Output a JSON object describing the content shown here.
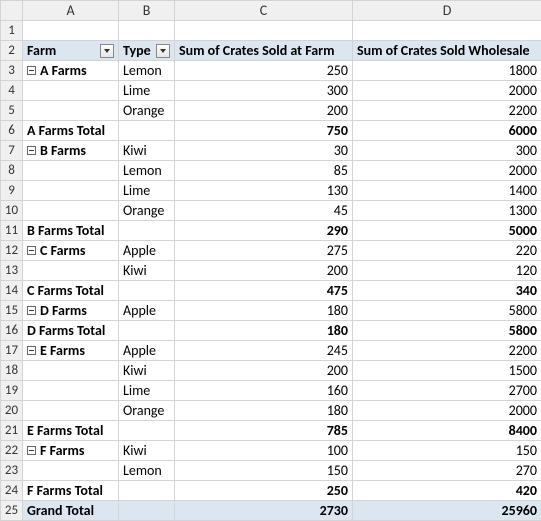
{
  "columns": [
    "A",
    "B",
    "C",
    "D"
  ],
  "header_row": 2,
  "headers": {
    "farm": "Farm",
    "type": "Type",
    "sum_farm": "Sum of Crates Sold at Farm",
    "sum_wholesale": "Sum of Crates Sold Wholesale"
  },
  "groups": [
    {
      "name": "A Farms",
      "rows": [
        {
          "type": "Lemon",
          "farm": 250,
          "whole": 1800
        },
        {
          "type": "Lime",
          "farm": 300,
          "whole": 2000
        },
        {
          "type": "Orange",
          "farm": 200,
          "whole": 2200
        }
      ],
      "subtotal": {
        "label": "A Farms Total",
        "farm": 750,
        "whole": 6000
      }
    },
    {
      "name": "B Farms",
      "rows": [
        {
          "type": "Kiwi",
          "farm": 30,
          "whole": 300
        },
        {
          "type": "Lemon",
          "farm": 85,
          "whole": 2000
        },
        {
          "type": "Lime",
          "farm": 130,
          "whole": 1400
        },
        {
          "type": "Orange",
          "farm": 45,
          "whole": 1300
        }
      ],
      "subtotal": {
        "label": "B Farms Total",
        "farm": 290,
        "whole": 5000
      }
    },
    {
      "name": "C Farms",
      "rows": [
        {
          "type": "Apple",
          "farm": 275,
          "whole": 220
        },
        {
          "type": "Kiwi",
          "farm": 200,
          "whole": 120
        }
      ],
      "subtotal": {
        "label": "C Farms Total",
        "farm": 475,
        "whole": 340
      }
    },
    {
      "name": "D Farms",
      "rows": [
        {
          "type": "Apple",
          "farm": 180,
          "whole": 5800
        }
      ],
      "subtotal": {
        "label": "D Farms Total",
        "farm": 180,
        "whole": 5800
      }
    },
    {
      "name": "E Farms",
      "rows": [
        {
          "type": "Apple",
          "farm": 245,
          "whole": 2200
        },
        {
          "type": "Kiwi",
          "farm": 200,
          "whole": 1500
        },
        {
          "type": "Lime",
          "farm": 160,
          "whole": 2700
        },
        {
          "type": "Orange",
          "farm": 180,
          "whole": 2000
        }
      ],
      "subtotal": {
        "label": "E Farms Total",
        "farm": 785,
        "whole": 8400
      }
    },
    {
      "name": "F Farms",
      "rows": [
        {
          "type": "Kiwi",
          "farm": 100,
          "whole": 150
        },
        {
          "type": "Lemon",
          "farm": 150,
          "whole": 270
        }
      ],
      "subtotal": {
        "label": "F Farms Total",
        "farm": 250,
        "whole": 420
      }
    }
  ],
  "grand_total": {
    "label": "Grand Total",
    "farm": 2730,
    "whole": 25960
  },
  "chart_data": {
    "type": "table",
    "title": "Pivot table: crates sold by farm and fruit type",
    "columns": [
      "Farm",
      "Type",
      "Sum of Crates Sold at Farm",
      "Sum of Crates Sold Wholesale"
    ],
    "rows": [
      [
        "A Farms",
        "Lemon",
        250,
        1800
      ],
      [
        "A Farms",
        "Lime",
        300,
        2000
      ],
      [
        "A Farms",
        "Orange",
        200,
        2200
      ],
      [
        "B Farms",
        "Kiwi",
        30,
        300
      ],
      [
        "B Farms",
        "Lemon",
        85,
        2000
      ],
      [
        "B Farms",
        "Lime",
        130,
        1400
      ],
      [
        "B Farms",
        "Orange",
        45,
        1300
      ],
      [
        "C Farms",
        "Apple",
        275,
        220
      ],
      [
        "C Farms",
        "Kiwi",
        200,
        120
      ],
      [
        "D Farms",
        "Apple",
        180,
        5800
      ],
      [
        "E Farms",
        "Apple",
        245,
        2200
      ],
      [
        "E Farms",
        "Kiwi",
        200,
        1500
      ],
      [
        "E Farms",
        "Lime",
        160,
        2700
      ],
      [
        "E Farms",
        "Orange",
        180,
        2000
      ],
      [
        "F Farms",
        "Kiwi",
        100,
        150
      ],
      [
        "F Farms",
        "Lemon",
        150,
        270
      ]
    ],
    "subtotals": [
      {
        "farm": "A Farms",
        "sum_farm": 750,
        "sum_wholesale": 6000
      },
      {
        "farm": "B Farms",
        "sum_farm": 290,
        "sum_wholesale": 5000
      },
      {
        "farm": "C Farms",
        "sum_farm": 475,
        "sum_wholesale": 340
      },
      {
        "farm": "D Farms",
        "sum_farm": 180,
        "sum_wholesale": 5800
      },
      {
        "farm": "E Farms",
        "sum_farm": 785,
        "sum_wholesale": 8400
      },
      {
        "farm": "F Farms",
        "sum_farm": 250,
        "sum_wholesale": 420
      }
    ],
    "grand_total": {
      "sum_farm": 2730,
      "sum_wholesale": 25960
    }
  }
}
